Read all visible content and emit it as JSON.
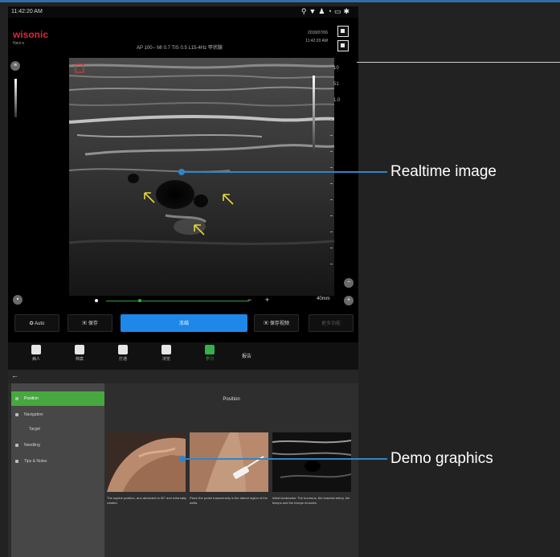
{
  "status_bar": {
    "time": "11:42:20 AM",
    "icons": [
      "usb-icon",
      "wifi-icon",
      "user-icon",
      "sync-icon",
      "display-icon",
      "gear-icon"
    ]
  },
  "header": {
    "brand": "wisonic",
    "sub_label": "Navi-s",
    "params": "AP 100-- MI 0.7 TIS 0.5 L15-4Hz 甲状腺",
    "date": "2018/07/06",
    "time": "11:42:20 AM"
  },
  "scale": {
    "labels": [
      "10",
      "51",
      "1.0"
    ],
    "depth": "40mm"
  },
  "controls": {
    "auto_label": "Auto",
    "save_image_label": "保存",
    "freeze_label": "冻结",
    "save_video_label": "保存视频",
    "fifth_label": "更多功能"
  },
  "nav": {
    "items": [
      {
        "label": "病人",
        "icon": "patient-icon"
      },
      {
        "label": "档案",
        "icon": "record-icon"
      },
      {
        "label": "打通",
        "icon": "transmit-icon"
      },
      {
        "label": "浏览",
        "icon": "browse-icon"
      },
      {
        "label": "学习",
        "icon": "learning-icon"
      }
    ],
    "extra_label": "报告"
  },
  "learning": {
    "menu": [
      "Position",
      "Navigation",
      "Target",
      "Needling",
      "Tips & Notes"
    ],
    "active_index": 0,
    "content_title": "Position",
    "captions": [
      "The supine position, arm abducted to 90° and externally rotated.",
      "Place the probe transversely in the lateral region of the axilla.",
      "Initial landmarks: The humerus, the brachial artery, the biceps and the triceps muscles."
    ]
  },
  "callouts": {
    "realtime": "Realtime image",
    "demo": "Demo graphics"
  },
  "colors": {
    "accent_blue": "#1f87e8",
    "active_green": "#46a83e",
    "callout_blue": "#2f86c7",
    "brand_red": "#e0233c"
  }
}
